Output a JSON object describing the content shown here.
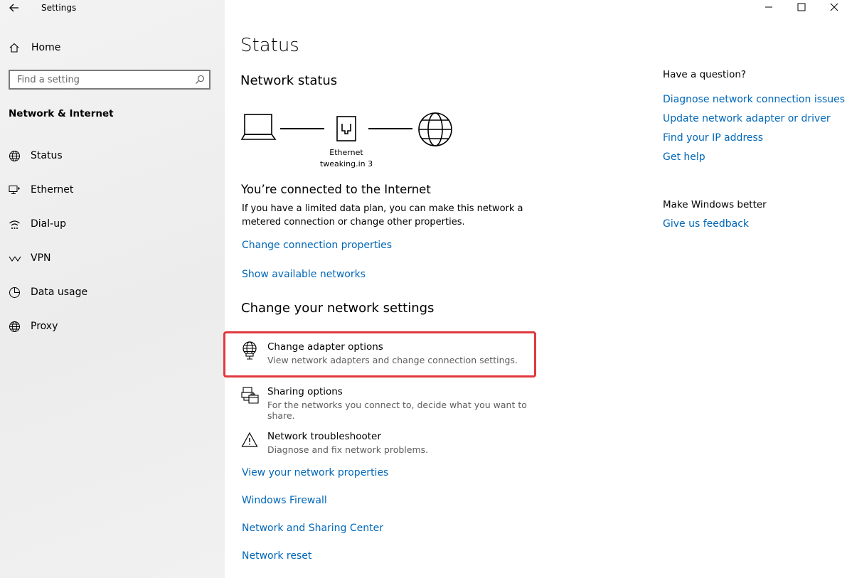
{
  "window": {
    "title": "Settings",
    "controls": [
      "minimize",
      "maximize",
      "close"
    ]
  },
  "sidebar": {
    "home_label": "Home",
    "search_placeholder": "Find a setting",
    "section_title": "Network & Internet",
    "items": [
      {
        "label": "Status",
        "icon": "globe-icon"
      },
      {
        "label": "Ethernet",
        "icon": "ethernet-icon"
      },
      {
        "label": "Dial-up",
        "icon": "dialup-icon"
      },
      {
        "label": "VPN",
        "icon": "vpn-icon"
      },
      {
        "label": "Data usage",
        "icon": "data-usage-icon"
      },
      {
        "label": "Proxy",
        "icon": "globe-icon"
      }
    ]
  },
  "main": {
    "page_title": "Status",
    "network_status_heading": "Network status",
    "adapter_name": "Ethernet",
    "network_name": "tweaking.in 3",
    "connected_heading": "You’re connected to the Internet",
    "connected_desc_line1": "If you have a limited data plan, you can make this network a",
    "connected_desc_line2": "metered connection or change other properties.",
    "link_change_connection": "Change connection properties",
    "link_show_networks": "Show available networks",
    "change_settings_heading": "Change your network settings",
    "options": [
      {
        "title": "Change adapter options",
        "desc": "View network adapters and change connection settings.",
        "icon": "adapter-icon"
      },
      {
        "title": "Sharing options",
        "desc": "For the networks you connect to, decide what you want to share.",
        "icon": "sharing-icon"
      },
      {
        "title": "Network troubleshooter",
        "desc": "Diagnose and fix network problems.",
        "icon": "warning-icon"
      }
    ],
    "bottom_links": [
      "View your network properties",
      "Windows Firewall",
      "Network and Sharing Center",
      "Network reset"
    ]
  },
  "right_panel": {
    "question_heading": "Have a question?",
    "question_links": [
      "Diagnose network connection issues",
      "Update network adapter or driver",
      "Find your IP address",
      "Get help"
    ],
    "feedback_heading": "Make Windows better",
    "feedback_link": "Give us feedback"
  },
  "colors": {
    "link": "#0067b8",
    "highlight_border": "#e0393e",
    "sidebar_bg": "#f2f2f2"
  }
}
